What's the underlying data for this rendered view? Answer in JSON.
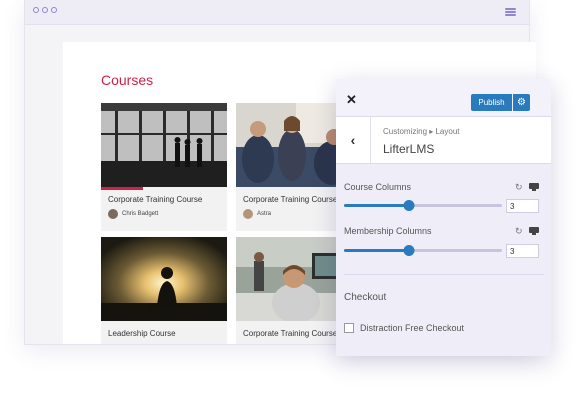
{
  "browser": {
    "menu_icon": "hamburger-icon",
    "dots_icon": "window-dots-icon"
  },
  "page": {
    "title": "Courses",
    "cards": [
      {
        "title": "Corporate Training Course",
        "author": "Chris Badgett",
        "image": "office-windows-photo"
      },
      {
        "title": "Corporate Training Course",
        "author": "Astra",
        "image": "meeting-photo"
      },
      {
        "title": "Leadership Course",
        "author": "",
        "image": "meditation-sunset-photo"
      },
      {
        "title": "Corporate Training Course",
        "author": "",
        "image": "smiling-man-computer-photo"
      }
    ]
  },
  "customizer": {
    "close_icon": "close-icon",
    "publish_label": "Publish",
    "settings_icon": "gear-icon",
    "back_icon": "chevron-left-icon",
    "breadcrumb": "Customizing ▸ Layout",
    "section_title": "LifterLMS",
    "controls": [
      {
        "label": "Course Columns",
        "value": "3",
        "slider_fraction": 0.41
      },
      {
        "label": "Membership Columns",
        "value": "3",
        "slider_fraction": 0.41
      }
    ],
    "checkout_heading": "Checkout",
    "checkbox_label": "Distraction Free Checkout",
    "checkbox_checked": false
  },
  "colors": {
    "accent": "#d21f45",
    "primary_button": "#2a7bbd",
    "window_chrome": "#8f86d1"
  }
}
